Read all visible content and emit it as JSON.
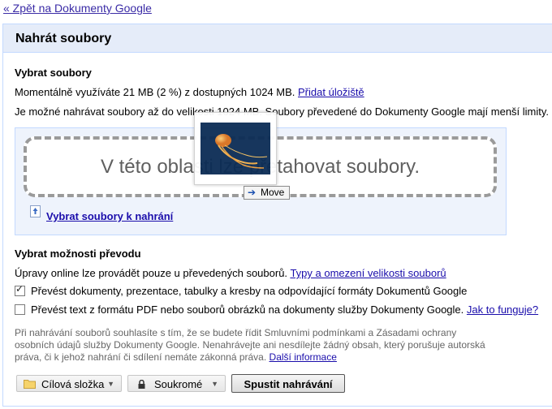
{
  "back_link": "« Zpět na Dokumenty Google",
  "panel": {
    "title": "Nahrát soubory",
    "select_heading": "Vybrat soubory",
    "usage_text": "Momentálně využíváte 21 MB (2 %) z dostupných 1024 MB.",
    "add_storage": "Přidat úložiště",
    "limit_text": "Je možné nahrávat soubory až do velikosti 1024 MB. Soubory převedené do Dokumenty Google mají menší limity.",
    "dropzone_text": "V této oblasti lze přetahovat soubory.",
    "select_files_link": "Vybrat soubory k nahrání",
    "drag_tooltip": "Move",
    "conversion_heading": "Vybrat možnosti převodu",
    "online_edit_text": "Úpravy online lze provádět pouze u převedených souborů.",
    "types_link": "Typy a omezení velikosti souborů",
    "options": [
      {
        "label": "Převést dokumenty, prezentace, tabulky a kresby na odpovídající formáty Dokumentů Google",
        "checked": true
      },
      {
        "label": "Převést text z formátu PDF nebo souborů obrázků na dokumenty služby Dokumenty Google.",
        "link": "Jak to funguje?",
        "checked": false
      }
    ],
    "terms_line1": "Při nahrávání souborů souhlasíte s tím, že se budete řídit Smluvními podmínkami a Zásadami ochrany",
    "terms_line2": "osobních údajů služby Dokumenty Google. Nenahrávejte ani nesdílejte žádný obsah, který porušuje autorská",
    "terms_line3": "práva, či k jehož nahrání či sdílení nemáte zákonná práva.",
    "more_info": "Další informace",
    "buttons": {
      "folder": "Cílová složka",
      "privacy": "Soukromé",
      "start": "Spustit nahrávání"
    }
  }
}
